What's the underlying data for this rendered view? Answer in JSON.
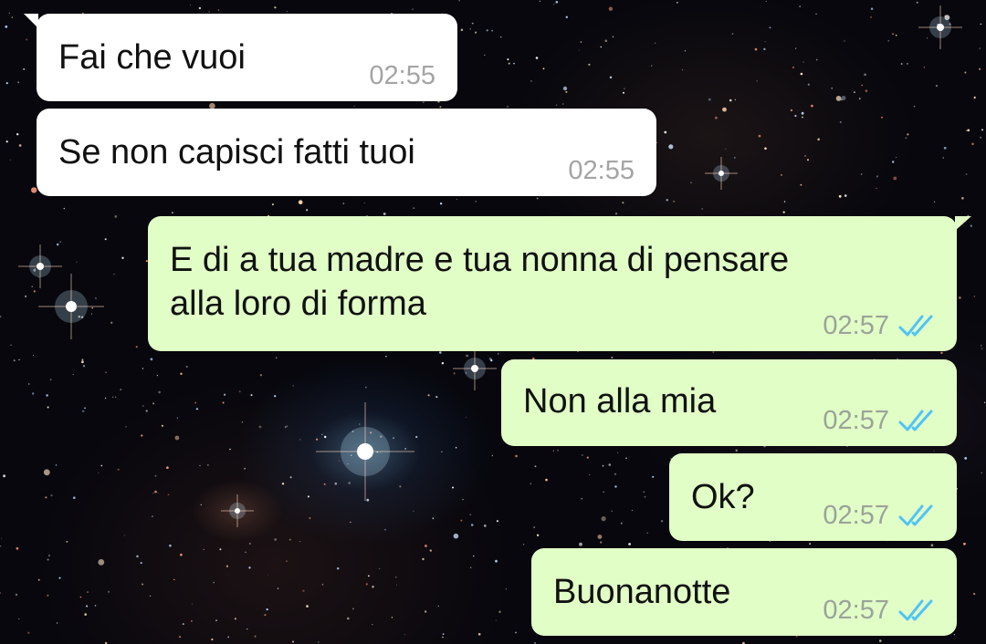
{
  "theme": {
    "incoming_bubble_color": "#ffffff",
    "outgoing_bubble_color": "#e1fec6",
    "read_receipt_color": "#4fc3f7",
    "wallpaper": "starfield"
  },
  "messages": [
    {
      "direction": "incoming",
      "text": "Fai che vuoi",
      "time": "02:55"
    },
    {
      "direction": "incoming",
      "text": "Se non capisci fatti tuoi",
      "time": "02:55"
    },
    {
      "direction": "outgoing",
      "text": "E di a tua madre e tua nonna di pensare\nalla loro di forma",
      "time": "02:57",
      "status": "read",
      "status_icon": "double-check-icon"
    },
    {
      "direction": "outgoing",
      "text": "Non alla mia",
      "time": "02:57",
      "status": "read",
      "status_icon": "double-check-icon"
    },
    {
      "direction": "outgoing",
      "text": "Ok?",
      "time": "02:57",
      "status": "read",
      "status_icon": "double-check-icon"
    },
    {
      "direction": "outgoing",
      "text": "Buonanotte",
      "time": "02:57",
      "status": "read",
      "status_icon": "double-check-icon"
    }
  ]
}
